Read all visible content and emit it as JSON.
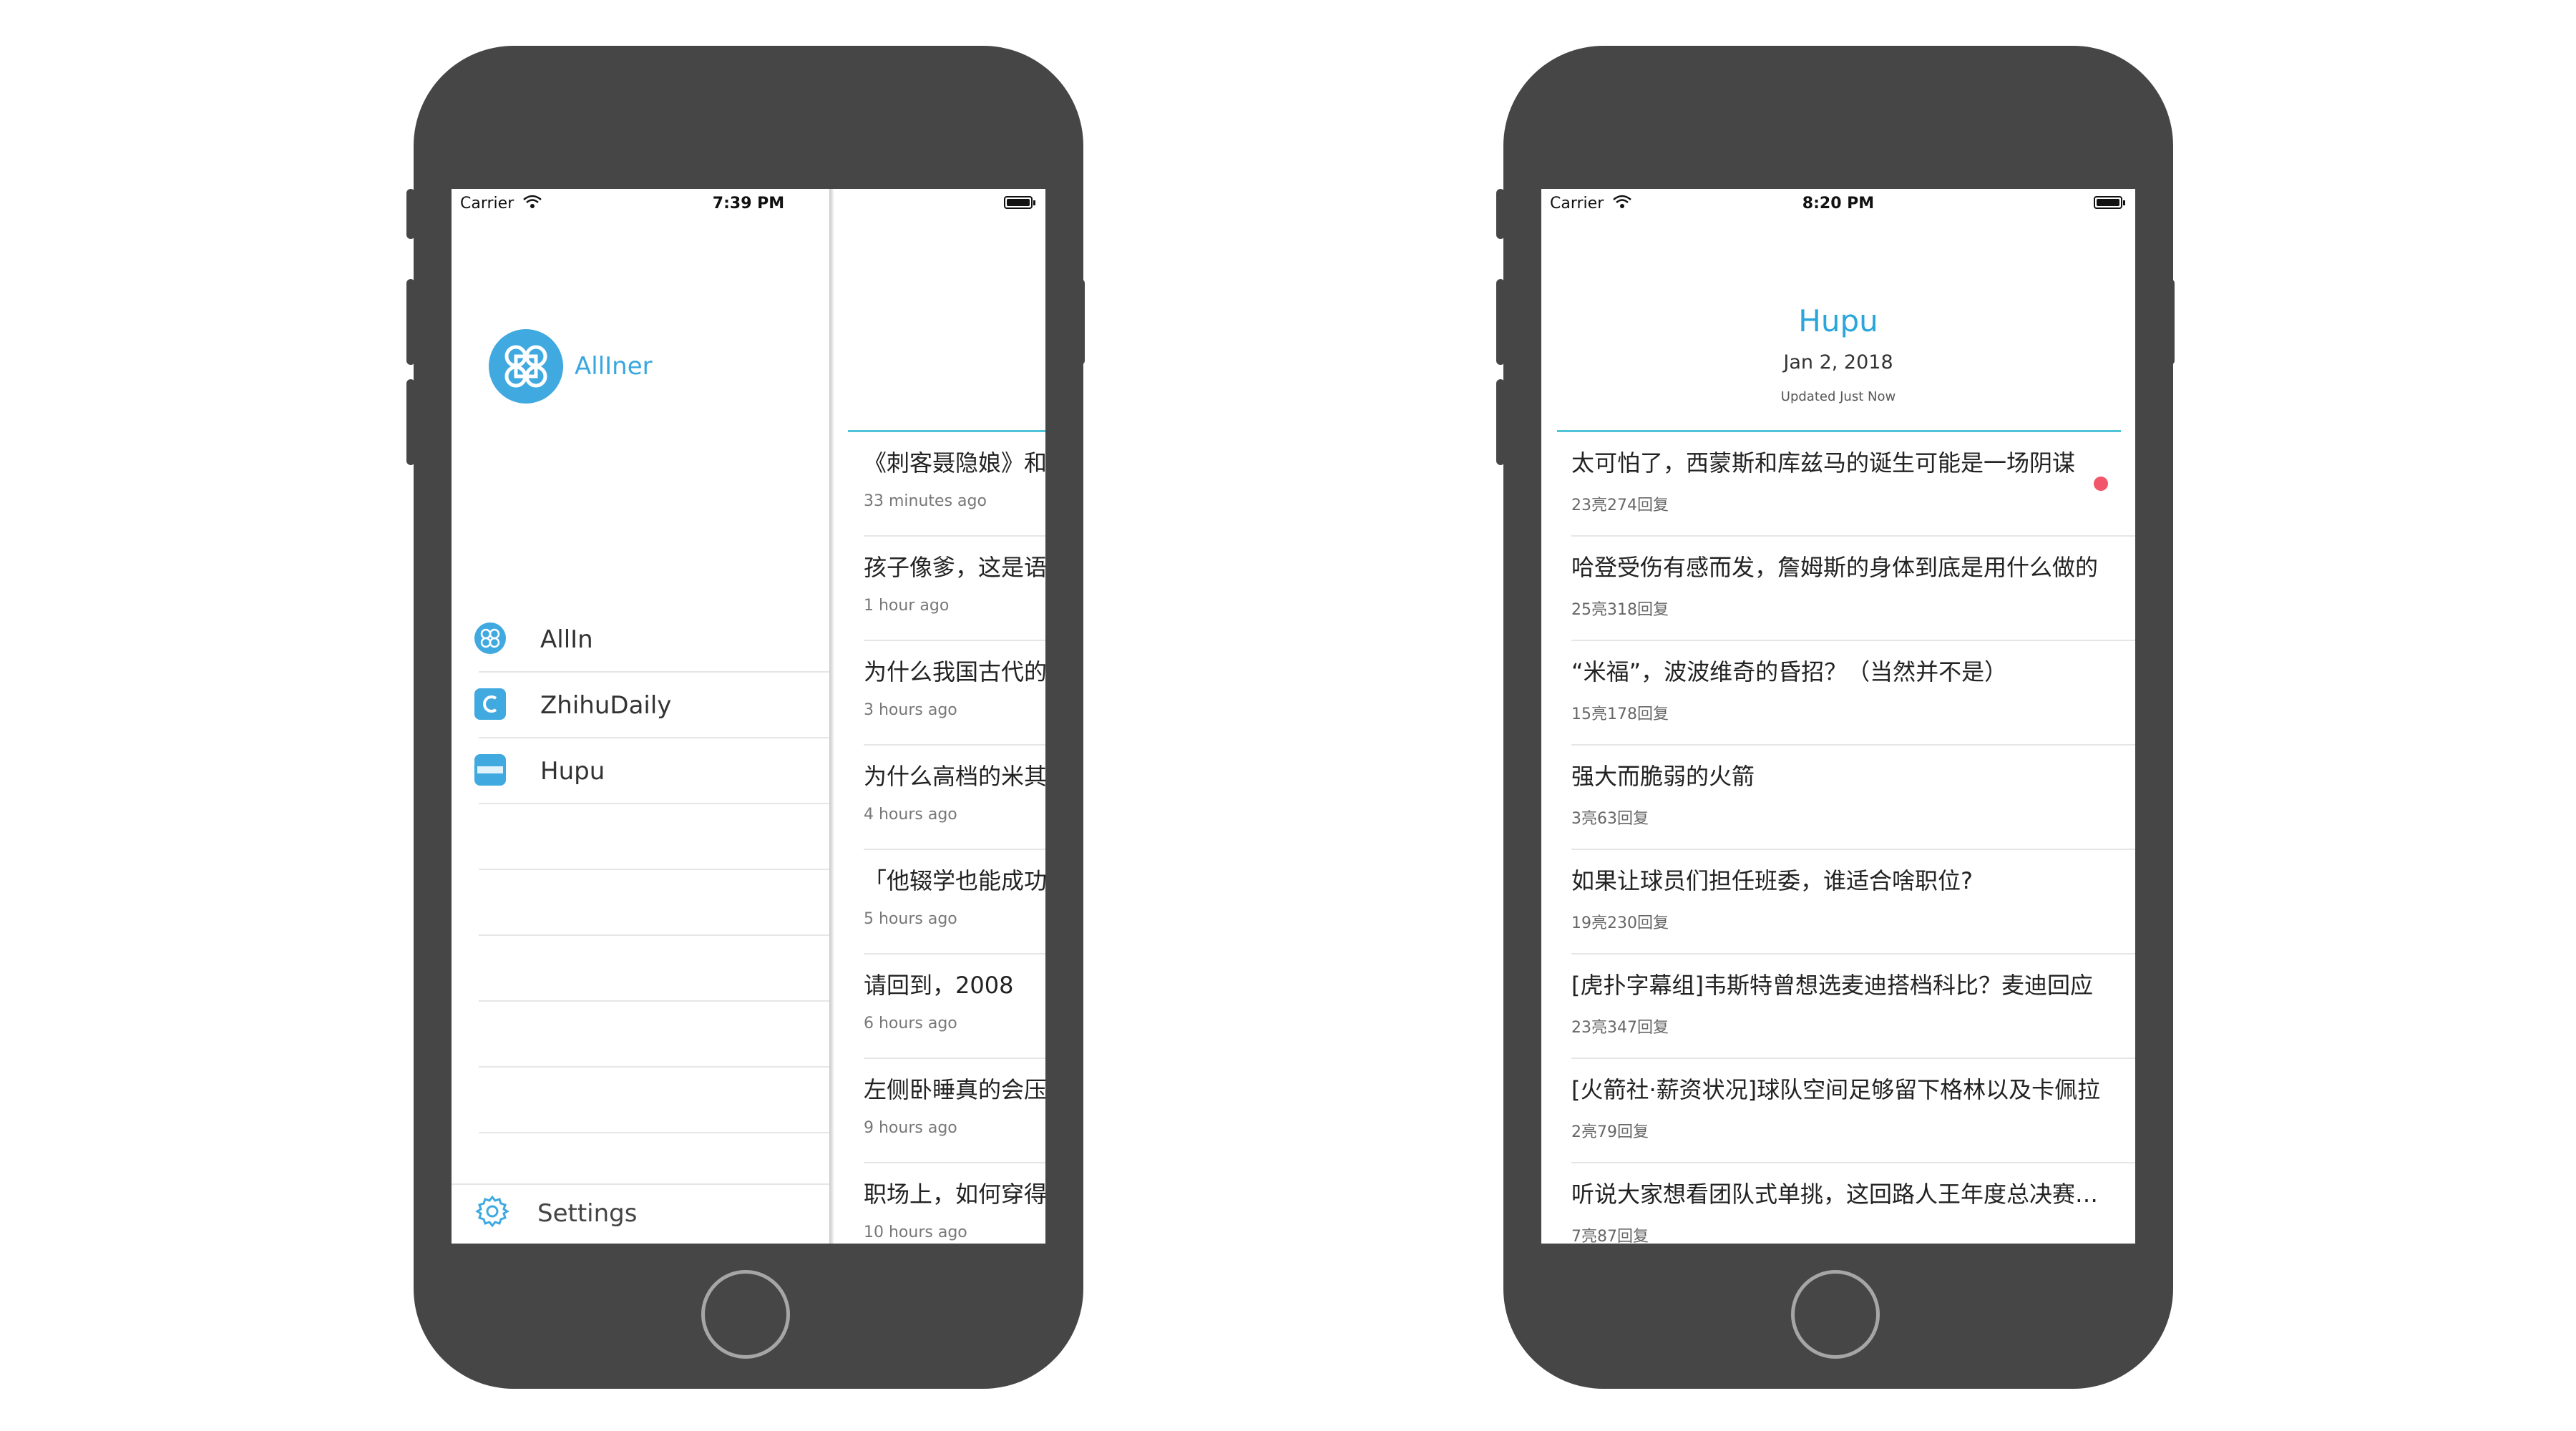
{
  "left_phone": {
    "status": {
      "carrier": "Carrier",
      "time": "7:39 PM"
    },
    "menu": {
      "brand": "AllIner",
      "items": [
        {
          "label": "AllIn",
          "icon": "allin-logo-icon"
        },
        {
          "label": "ZhihuDaily",
          "icon": "zhihu-daily-icon"
        },
        {
          "label": "Hupu",
          "icon": "hupu-icon"
        }
      ],
      "settings_label": "Settings"
    },
    "peek_feed": [
      {
        "title": "《刺客聂隐娘》和",
        "time": "33 minutes ago"
      },
      {
        "title": "孩子像爹，这是语",
        "time": "1 hour ago"
      },
      {
        "title": "为什么我国古代的",
        "time": "3 hours ago"
      },
      {
        "title": "为什么高档的米其",
        "time": "4 hours ago"
      },
      {
        "title": "「他辍学也能成功",
        "time": "5 hours ago"
      },
      {
        "title": "请回到，2008",
        "time": "6 hours ago"
      },
      {
        "title": "左侧卧睡真的会压",
        "time": "9 hours ago"
      },
      {
        "title": "职场上，如何穿得",
        "time": "10 hours ago"
      }
    ]
  },
  "right_phone": {
    "status": {
      "carrier": "Carrier",
      "time": "8:20 PM"
    },
    "header": {
      "title": "Hupu",
      "date": "Jan 2, 2018",
      "updated": "Updated Just Now"
    },
    "items": [
      {
        "title": "太可怕了，西蒙斯和库兹马的诞生可能是一场阴谋",
        "meta": "23亮274回复",
        "unread": true
      },
      {
        "title": "哈登受伤有感而发，詹姆斯的身体到底是用什么做的",
        "meta": "25亮318回复",
        "unread": false
      },
      {
        "title": "“米福”，波波维奇的昏招？（当然并不是）",
        "meta": "15亮178回复",
        "unread": false
      },
      {
        "title": "强大而脆弱的火箭",
        "meta": "3亮63回复",
        "unread": false
      },
      {
        "title": "如果让球员们担任班委，谁适合啥职位?",
        "meta": "19亮230回复",
        "unread": false
      },
      {
        "title": "[虎扑字幕组]韦斯特曾想选麦迪搭档科比？麦迪回应",
        "meta": "23亮347回复",
        "unread": false
      },
      {
        "title": "[火箭社·薪资状况]球队空间足够留下格林以及卡佩拉",
        "meta": "2亮79回复",
        "unread": false
      },
      {
        "title": "听说大家想看团队式单挑，这回路人王年度总决赛来了",
        "meta": "7亮87回复",
        "unread": false
      }
    ]
  }
}
